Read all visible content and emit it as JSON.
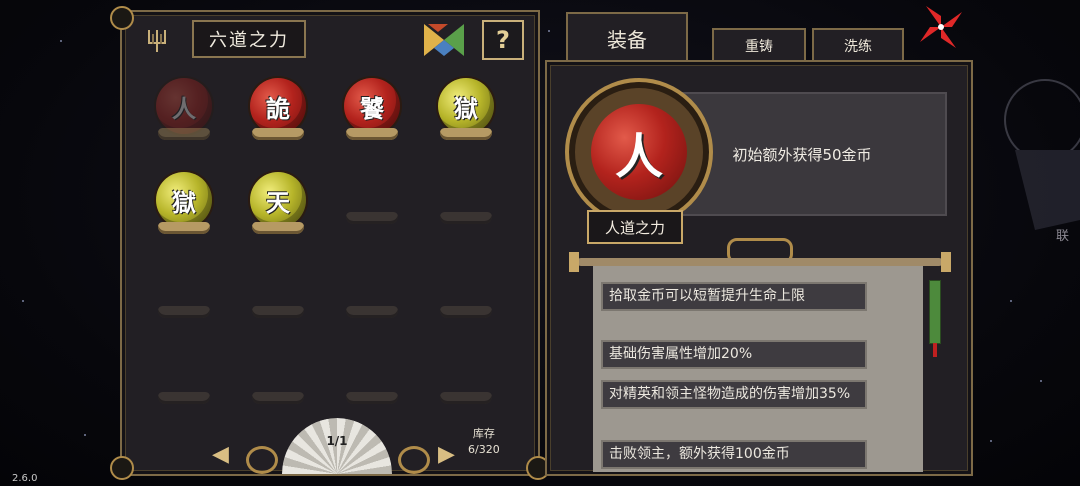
{
  "version": "2.6.0",
  "left_panel": {
    "title": "六道之力",
    "help_label": "?",
    "orbs": [
      {
        "char": "人",
        "color": "red",
        "dim": true
      },
      {
        "char": "詭",
        "color": "red",
        "dim": false
      },
      {
        "char": "饕",
        "color": "red",
        "dim": false
      },
      {
        "char": "獄",
        "color": "gold",
        "dim": false
      },
      {
        "char": "獄",
        "color": "gold",
        "dim": false
      },
      {
        "char": "天",
        "color": "gold",
        "dim": false
      }
    ],
    "page": "1/1",
    "prev_arrow": "◀",
    "next_arrow": "▶",
    "stock_label": "库存",
    "stock_value": "6/320"
  },
  "tabs": {
    "equip": "装备",
    "recast": "重铸",
    "refine": "洗练"
  },
  "detail": {
    "orb_char": "人",
    "name": "人道之力",
    "description": "初始额外获得50金币",
    "effects": [
      "拾取金币可以短暂提升生命上限",
      "基础伤害属性增加20%",
      "对精英和领主怪物造成的伤害增加35%",
      "击败领主，额外获得100金币"
    ]
  },
  "background": {
    "side_label": "联"
  },
  "colors": {
    "panel_bg": "#221f24",
    "gold_border": "#7d6a47",
    "orb_red": "#b3231d",
    "orb_gold": "#b7b52a",
    "scroll_bg": "#9d9890"
  }
}
